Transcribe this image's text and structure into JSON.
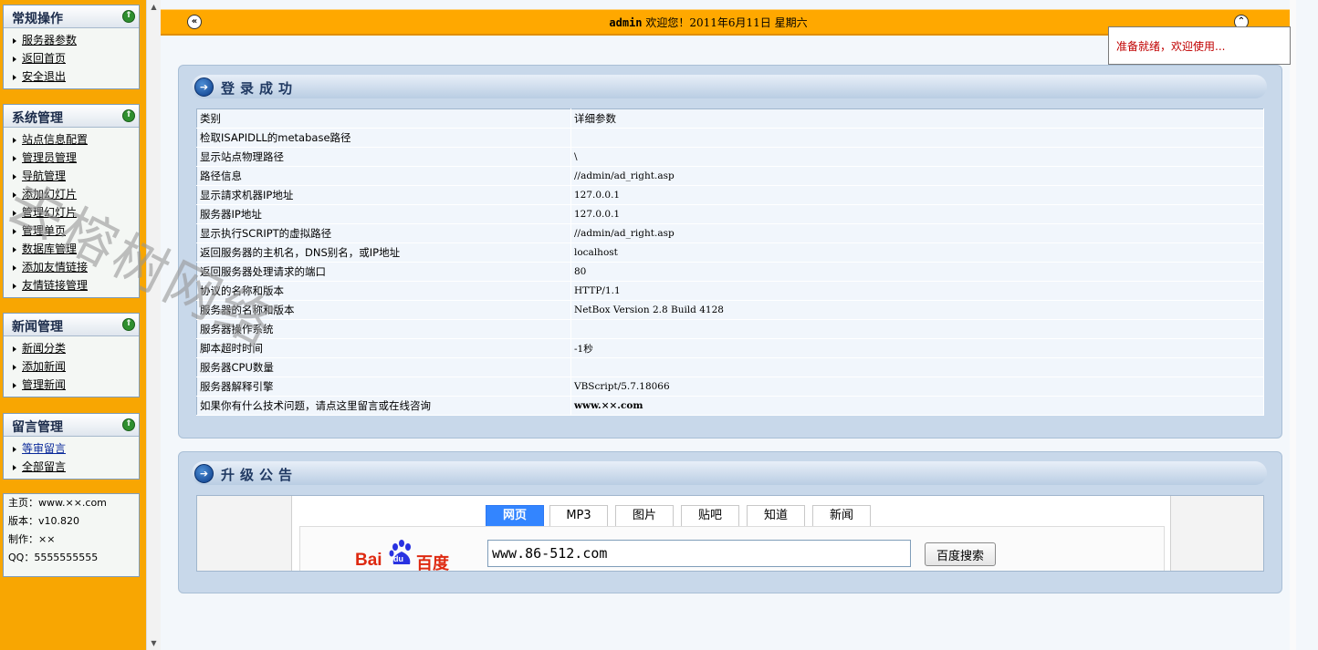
{
  "sidebar": {
    "panels": [
      {
        "title": "常规操作",
        "items": [
          "服务器参数",
          "返回首页",
          "安全退出"
        ]
      },
      {
        "title": "系统管理",
        "items": [
          "站点信息配置",
          "管理员管理",
          "导航管理",
          "添加幻灯片",
          "管理幻灯片",
          "管理单页",
          "数据库管理",
          "添加友情链接",
          "友情链接管理"
        ]
      },
      {
        "title": "新闻管理",
        "items": [
          "新闻分类",
          "添加新闻",
          "管理新闻"
        ]
      },
      {
        "title": "留言管理",
        "items": [
          "等审留言",
          "全部留言"
        ]
      }
    ],
    "info": {
      "homepage": "主页：www.××.com",
      "version": "版本：v10.820",
      "author": "制作：××",
      "qq": "QQ：5555555555"
    },
    "watermark": "去榕树网络"
  },
  "topbar": {
    "user": "admin",
    "welcome": "欢迎您！2011年6月11日  星期六",
    "status": "准备就绪，欢迎使用..."
  },
  "login_section": {
    "title": "登录成功",
    "header": [
      "类别",
      "详细参数"
    ],
    "rows": [
      [
        "检取ISAPIDLL的metabase路径",
        ""
      ],
      [
        "显示站点物理路径",
        "\\"
      ],
      [
        "路径信息",
        "//admin/ad_right.asp"
      ],
      [
        "显示請求机器IP地址",
        "127.0.0.1"
      ],
      [
        "服务器IP地址",
        "127.0.0.1"
      ],
      [
        "显示执行SCRIPT的虚拟路径",
        "//admin/ad_right.asp"
      ],
      [
        "返回服务器的主机名，DNS别名，或IP地址",
        "localhost"
      ],
      [
        "返回服务器处理请求的端口",
        "80"
      ],
      [
        "协议的名称和版本",
        "HTTP/1.1"
      ],
      [
        "服务器的名称和版本",
        "NetBox Version 2.8 Build 4128"
      ],
      [
        "服务器操作系统",
        ""
      ],
      [
        "脚本超时时间",
        "-1秒"
      ],
      [
        "服务器CPU数量",
        ""
      ],
      [
        "服务器解释引擎",
        "VBScript/5.7.18066"
      ],
      [
        "如果你有什么技术问题，请点这里留言或在线咨询",
        "www.××.com"
      ]
    ]
  },
  "upgrade_section": {
    "title": "升级公告",
    "baidu": {
      "tabs": [
        "网页",
        "MP3",
        "图片",
        "贴吧",
        "知道",
        "新闻"
      ],
      "logo_bai": "Bai",
      "logo_du": "du",
      "logo_cn": "百度",
      "search_value": "www.86-512.com",
      "search_button": "百度搜索"
    }
  }
}
